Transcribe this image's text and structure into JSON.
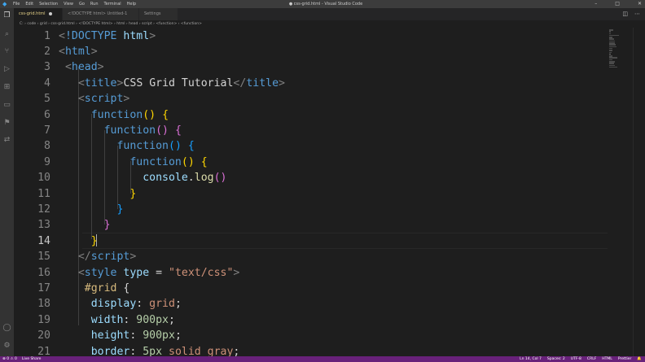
{
  "titlebar": {
    "menu": [
      "File",
      "Edit",
      "Selection",
      "View",
      "Go",
      "Run",
      "Terminal",
      "Help"
    ],
    "window_title": "● css-grid.html - Visual Studio Code",
    "controls": [
      "–",
      "□",
      "✕"
    ]
  },
  "tabs": [
    {
      "label": "css-grid.html",
      "active": true,
      "dirty": true
    },
    {
      "label": "<!DOCTYPE html> Untitled-1",
      "active": false,
      "dirty": true
    },
    {
      "label": "Settings",
      "active": false,
      "dirty": false
    }
  ],
  "breadcrumb": [
    "C:",
    "code",
    "grid",
    "css-grid.html",
    "<!DOCTYPE html>",
    "html",
    "head",
    "script",
    "<function>",
    "<function>"
  ],
  "editor": {
    "current_line": 14,
    "lines": [
      {
        "n": "1"
      },
      {
        "n": "2"
      },
      {
        "n": "3"
      },
      {
        "n": "4"
      },
      {
        "n": "5"
      },
      {
        "n": "6"
      },
      {
        "n": "7"
      },
      {
        "n": "8"
      },
      {
        "n": "9"
      },
      {
        "n": "10"
      },
      {
        "n": "11"
      },
      {
        "n": "12"
      },
      {
        "n": "13"
      },
      {
        "n": "14"
      },
      {
        "n": "15"
      },
      {
        "n": "16"
      },
      {
        "n": "17"
      },
      {
        "n": "18"
      },
      {
        "n": "19"
      },
      {
        "n": "20"
      },
      {
        "n": "21"
      }
    ],
    "code_tokens": [
      [
        [
          "t-br",
          "<"
        ],
        [
          "t-tag",
          "!DOCTYPE"
        ],
        [
          "t-attr",
          " html"
        ],
        [
          "t-br",
          ">"
        ]
      ],
      [
        [
          "t-br",
          "<"
        ],
        [
          "t-tag",
          "html"
        ],
        [
          "t-br",
          ">"
        ]
      ],
      [
        [
          "t-text",
          " "
        ],
        [
          "t-br",
          "<"
        ],
        [
          "t-tag",
          "head"
        ],
        [
          "t-br",
          ">"
        ]
      ],
      [
        [
          "t-text",
          "   "
        ],
        [
          "t-br",
          "<"
        ],
        [
          "t-tag",
          "title"
        ],
        [
          "t-br",
          ">"
        ],
        [
          "t-text",
          "CSS Grid Tutorial"
        ],
        [
          "t-br",
          "</"
        ],
        [
          "t-tag",
          "title"
        ],
        [
          "t-br",
          ">"
        ]
      ],
      [
        [
          "t-text",
          "   "
        ],
        [
          "t-br",
          "<"
        ],
        [
          "t-tag",
          "script"
        ],
        [
          "t-br",
          ">"
        ]
      ],
      [
        [
          "t-text",
          "     "
        ],
        [
          "t-kw",
          "function"
        ],
        [
          "t-p1",
          "()"
        ],
        [
          "t-text",
          " "
        ],
        [
          "t-p1",
          "{"
        ]
      ],
      [
        [
          "t-text",
          "       "
        ],
        [
          "t-kw",
          "function"
        ],
        [
          "t-p2",
          "()"
        ],
        [
          "t-text",
          " "
        ],
        [
          "t-p2",
          "{"
        ]
      ],
      [
        [
          "t-text",
          "         "
        ],
        [
          "t-kw",
          "function"
        ],
        [
          "t-p3",
          "()"
        ],
        [
          "t-text",
          " "
        ],
        [
          "t-p3",
          "{"
        ]
      ],
      [
        [
          "t-text",
          "           "
        ],
        [
          "t-kw",
          "function"
        ],
        [
          "t-p1",
          "()"
        ],
        [
          "t-text",
          " "
        ],
        [
          "t-p1",
          "{"
        ]
      ],
      [
        [
          "t-text",
          "             "
        ],
        [
          "t-var",
          "console"
        ],
        [
          "t-text",
          "."
        ],
        [
          "t-fn",
          "log"
        ],
        [
          "t-p2",
          "()"
        ]
      ],
      [
        [
          "t-text",
          "           "
        ],
        [
          "t-p1",
          "}"
        ]
      ],
      [
        [
          "t-text",
          "         "
        ],
        [
          "t-p3",
          "}"
        ]
      ],
      [
        [
          "t-text",
          "       "
        ],
        [
          "t-p2",
          "}"
        ]
      ],
      [
        [
          "t-text",
          "     "
        ],
        [
          "t-p1",
          "}"
        ]
      ],
      [
        [
          "t-text",
          "   "
        ],
        [
          "t-br",
          "</"
        ],
        [
          "t-tag",
          "script"
        ],
        [
          "t-br",
          ">"
        ]
      ],
      [
        [
          "t-text",
          "   "
        ],
        [
          "t-br",
          "<"
        ],
        [
          "t-tag",
          "style"
        ],
        [
          "t-attr",
          " type"
        ],
        [
          "t-text",
          " = "
        ],
        [
          "t-str",
          "\"text/css\""
        ],
        [
          "t-br",
          ">"
        ]
      ],
      [
        [
          "t-text",
          "    "
        ],
        [
          "t-sel",
          "#grid"
        ],
        [
          "t-text",
          " {"
        ]
      ],
      [
        [
          "t-text",
          "     "
        ],
        [
          "t-prop",
          "display"
        ],
        [
          "t-text",
          ": "
        ],
        [
          "t-str",
          "grid"
        ],
        [
          "t-text",
          ";"
        ]
      ],
      [
        [
          "t-text",
          "     "
        ],
        [
          "t-prop",
          "width"
        ],
        [
          "t-text",
          ": "
        ],
        [
          "t-num",
          "900px"
        ],
        [
          "t-text",
          ";"
        ]
      ],
      [
        [
          "t-text",
          "     "
        ],
        [
          "t-prop",
          "height"
        ],
        [
          "t-text",
          ": "
        ],
        [
          "t-num",
          "900px"
        ],
        [
          "t-text",
          ";"
        ]
      ],
      [
        [
          "t-text",
          "     "
        ],
        [
          "t-prop",
          "border"
        ],
        [
          "t-text",
          ": "
        ],
        [
          "t-num",
          "5px"
        ],
        [
          "t-str",
          " solid gray"
        ],
        [
          "t-text",
          ";"
        ]
      ]
    ]
  },
  "statusbar": {
    "left": [
      "⊗ 0 ⚠ 0",
      "Live Share"
    ],
    "right": [
      "Ln 14, Col 7",
      "Spaces: 2",
      "UTF-8",
      "CRLF",
      "HTML",
      "Prettier",
      "🔔"
    ]
  },
  "icons": {
    "explorer": "files-icon",
    "search": "search-icon",
    "scm": "source-control-icon",
    "debug": "run-debug-icon",
    "extensions": "extensions-icon",
    "remote": "remote-explorer-icon",
    "bookmarks": "bookmark-icon",
    "liveshare": "live-share-icon",
    "account": "account-icon",
    "settings": "gear-icon"
  }
}
